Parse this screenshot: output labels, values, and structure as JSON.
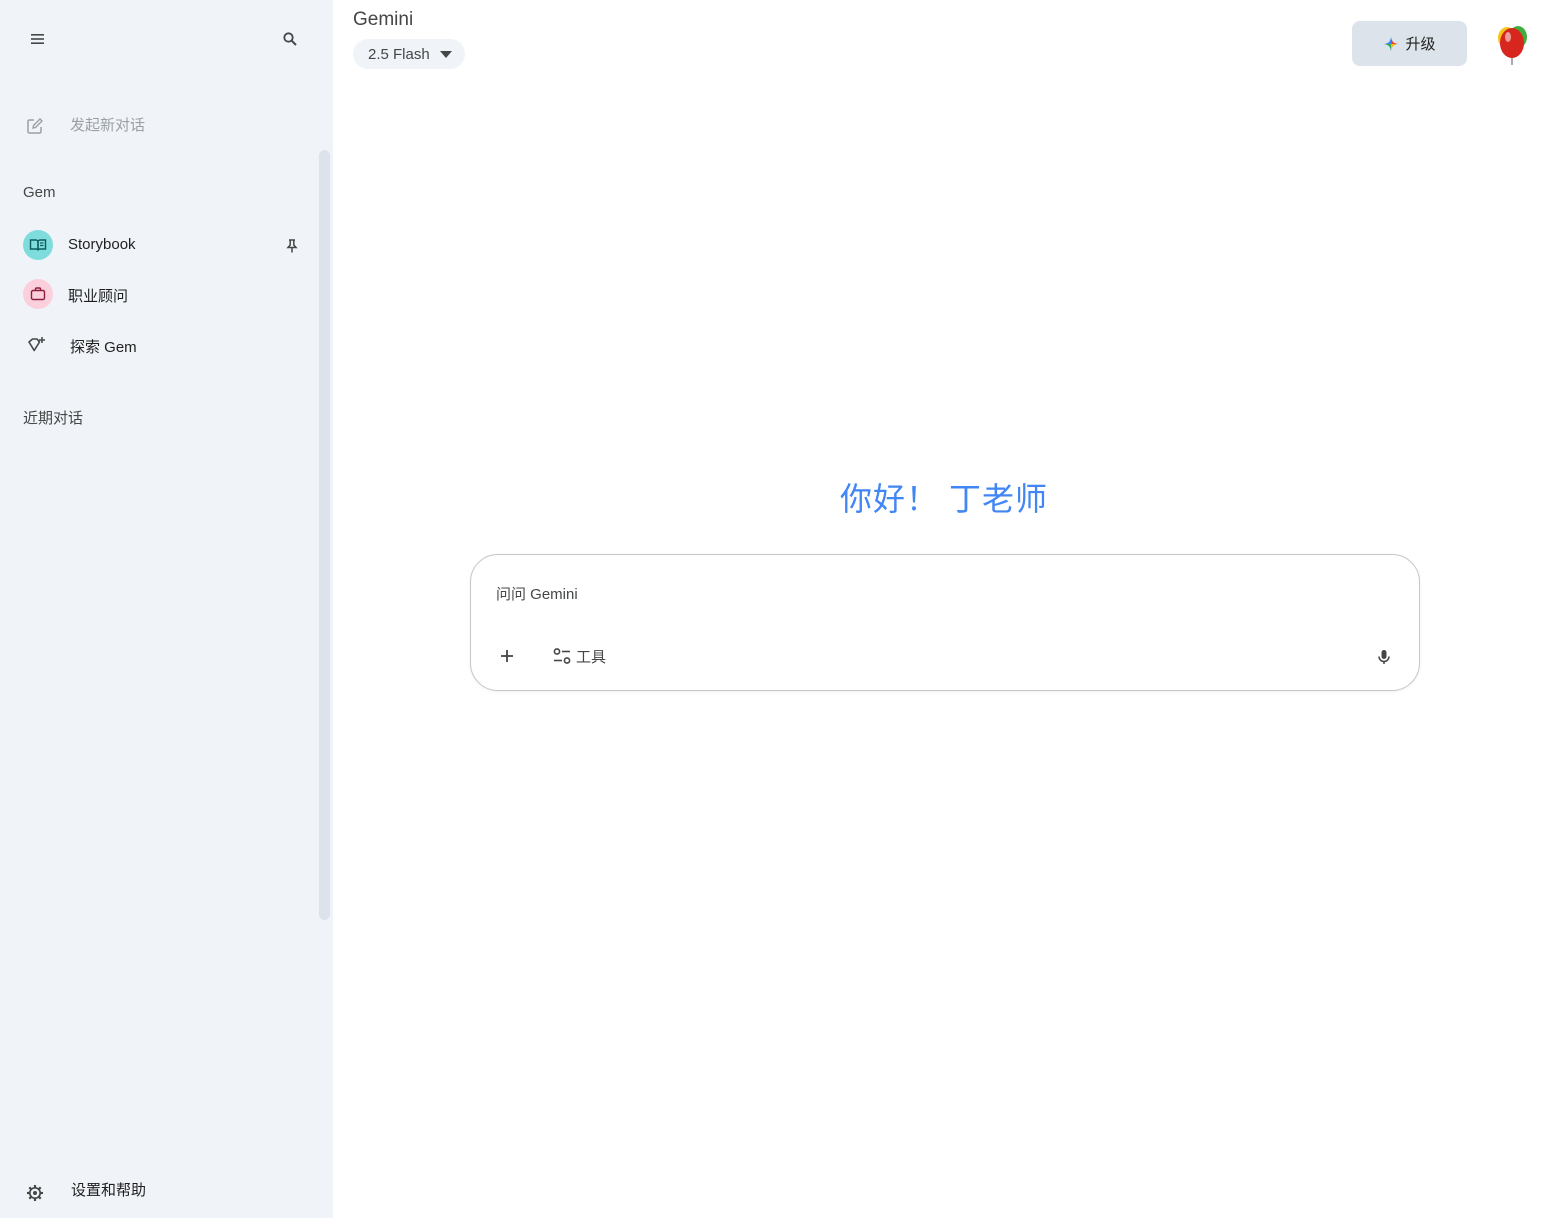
{
  "sidebar": {
    "new_chat_label": "发起新对话",
    "gem_section_title": "Gem",
    "gems": [
      {
        "label": "Storybook",
        "icon": "book-icon",
        "color": "#7fdcdc"
      },
      {
        "label": "职业顾问",
        "icon": "briefcase-icon",
        "color": "#fbd0dc"
      },
      {
        "label": "探索 Gem",
        "icon": "gem-sparkle-icon"
      }
    ],
    "recent_section_title": "近期对话",
    "settings_label": "设置和帮助"
  },
  "header": {
    "title": "Gemini",
    "model_label": "2.5 Flash",
    "upgrade_label": "升级"
  },
  "main": {
    "greeting": "你好！ 丁老师",
    "input_placeholder": "问问 Gemini",
    "tools_label": "工具"
  },
  "colors": {
    "accent": "#4285f4",
    "sidebar_bg": "#f0f4f9"
  }
}
